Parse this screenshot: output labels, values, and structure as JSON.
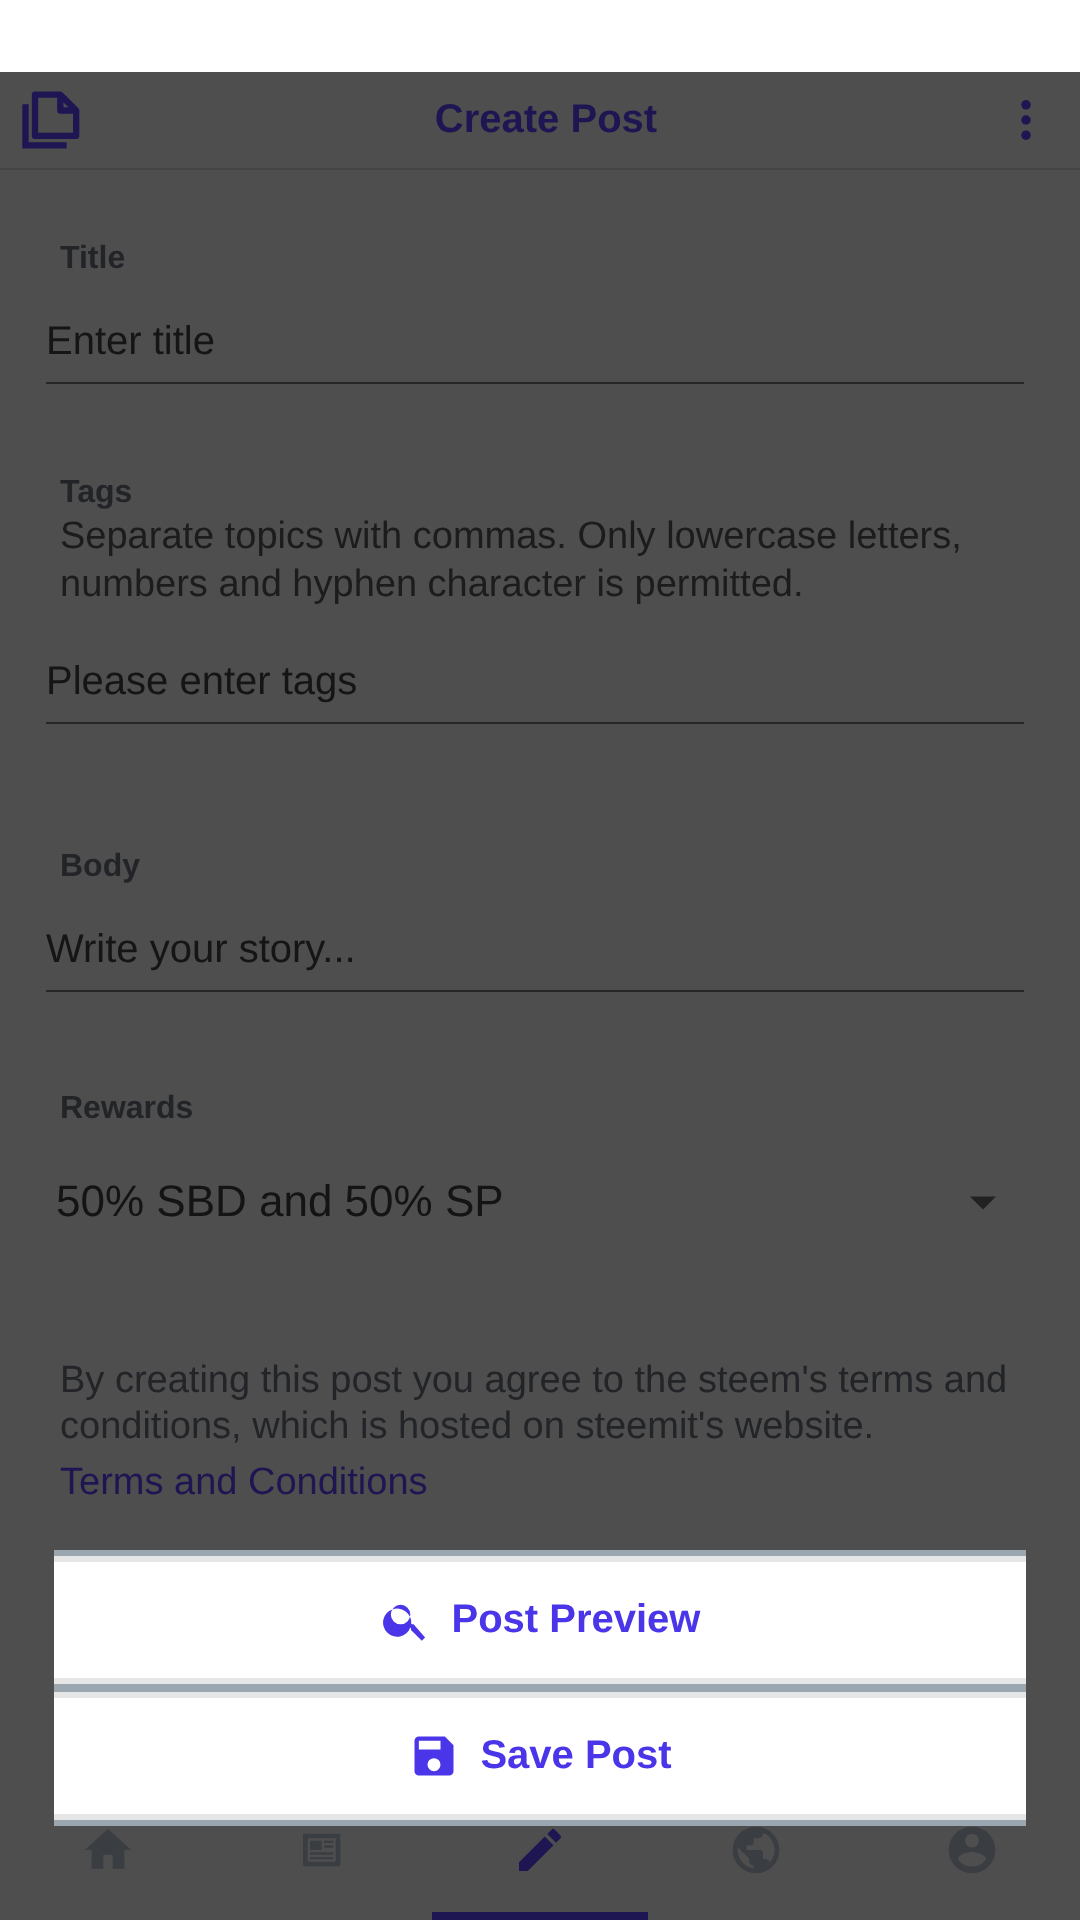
{
  "app_bar": {
    "title": "Create Post"
  },
  "fields": [
    {
      "label": "Title",
      "placeholder": "Enter title"
    },
    {
      "label": "Tags",
      "help": "Separate topics with commas. Only lowercase letters, numbers and hyphen character is permitted.",
      "placeholder": "Please enter tags"
    },
    {
      "label": "Body",
      "placeholder": "Write your story..."
    }
  ],
  "rewards": {
    "label": "Rewards",
    "value": "50% SBD and 50% SP"
  },
  "terms": {
    "text": "By creating this post you agree to the steem's terms and conditions, which is hosted on steemit's website.",
    "link": "Terms and Conditions"
  },
  "bottom_nav": [
    {
      "kind": "home",
      "selected": false
    },
    {
      "kind": "news",
      "selected": false
    },
    {
      "kind": "edit",
      "selected": true
    },
    {
      "kind": "globe",
      "selected": false
    },
    {
      "kind": "account",
      "selected": false
    }
  ],
  "sheet": [
    {
      "kind": "search",
      "label": "Post Preview"
    },
    {
      "kind": "save",
      "label": "Save Post"
    }
  ]
}
